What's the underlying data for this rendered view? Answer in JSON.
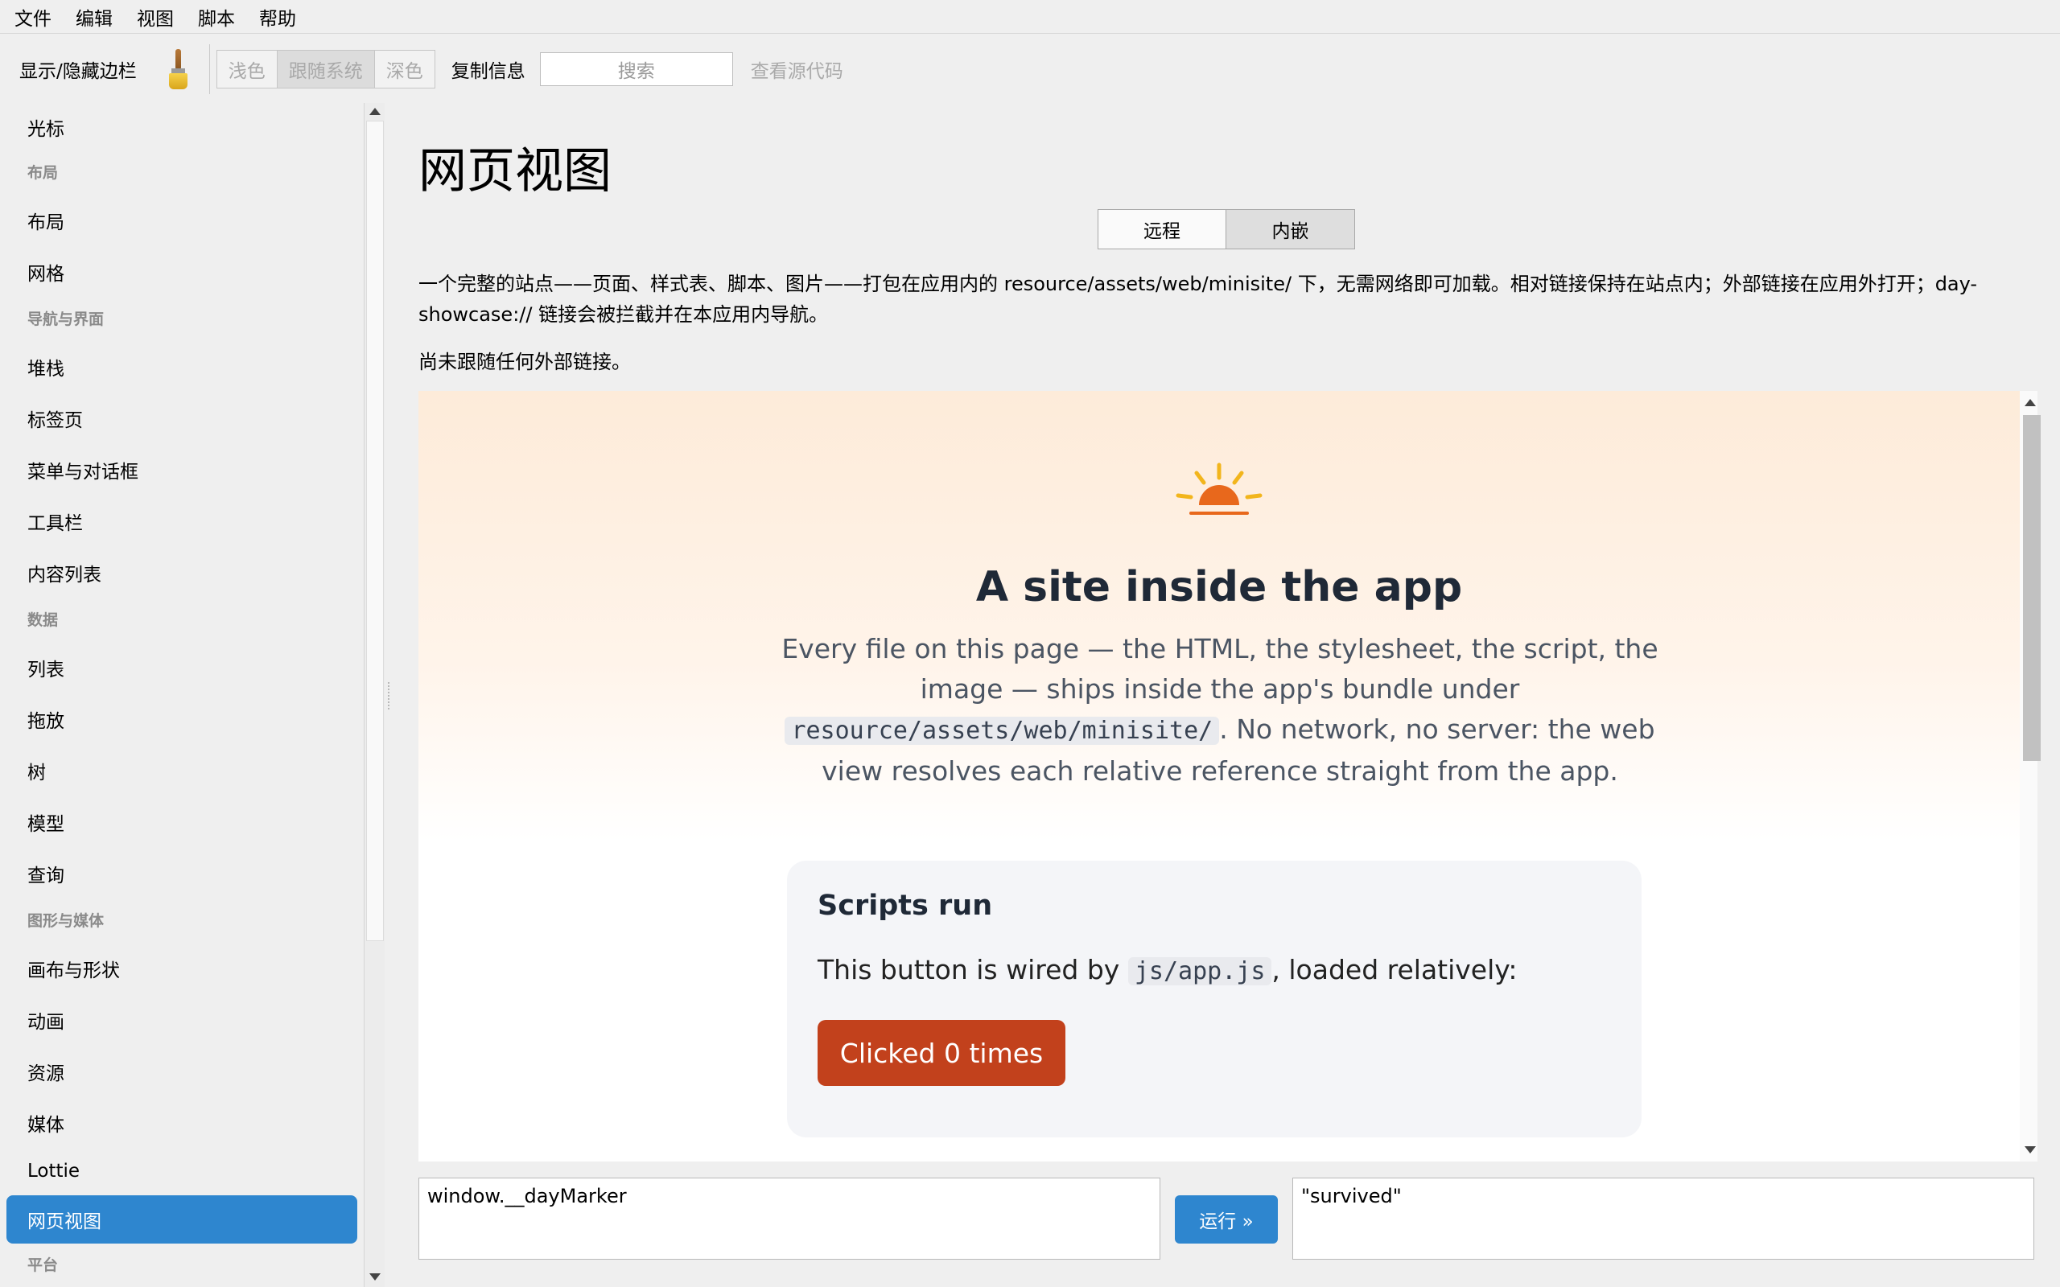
{
  "menubar": {
    "items": [
      {
        "label": "文件"
      },
      {
        "label": "编辑"
      },
      {
        "label": "视图"
      },
      {
        "label": "脚本"
      },
      {
        "label": "帮助"
      }
    ]
  },
  "toolbar": {
    "toggle_sidebar": "显示/隐藏边栏",
    "brush_icon": "paintbrush-icon",
    "theme_light": "浅色",
    "theme_system": "跟随系统",
    "theme_dark": "深色",
    "copy_info": "复制信息",
    "search_placeholder": "搜索",
    "view_source": "查看源代码"
  },
  "sidebar": {
    "items": [
      {
        "type": "item",
        "label": "光标"
      },
      {
        "type": "header",
        "label": "布局"
      },
      {
        "type": "item",
        "label": "布局"
      },
      {
        "type": "item",
        "label": "网格"
      },
      {
        "type": "header",
        "label": "导航与界面"
      },
      {
        "type": "item",
        "label": "堆栈"
      },
      {
        "type": "item",
        "label": "标签页"
      },
      {
        "type": "item",
        "label": "菜单与对话框"
      },
      {
        "type": "item",
        "label": "工具栏"
      },
      {
        "type": "item",
        "label": "内容列表"
      },
      {
        "type": "header",
        "label": "数据"
      },
      {
        "type": "item",
        "label": "列表"
      },
      {
        "type": "item",
        "label": "拖放"
      },
      {
        "type": "item",
        "label": "树"
      },
      {
        "type": "item",
        "label": "模型"
      },
      {
        "type": "item",
        "label": "查询"
      },
      {
        "type": "header",
        "label": "图形与媒体"
      },
      {
        "type": "item",
        "label": "画布与形状"
      },
      {
        "type": "item",
        "label": "动画"
      },
      {
        "type": "item",
        "label": "资源"
      },
      {
        "type": "item",
        "label": "媒体"
      },
      {
        "type": "item",
        "label": "Lottie"
      },
      {
        "type": "item",
        "label": "网页视图",
        "selected": true
      },
      {
        "type": "header",
        "label": "平台"
      }
    ],
    "selected_color": "#2e86cf"
  },
  "main": {
    "title": "网页视图",
    "modes": {
      "remote": "远程",
      "embedded": "内嵌",
      "active": "embedded"
    },
    "description": "一个完整的站点——页面、样式表、脚本、图片——打包在应用内的 resource/assets/web/minisite/ 下，无需网络即可加载。相对链接保持在站点内；外部链接在应用外打开；day-showcase:// 链接会被拦截并在本应用内导航。",
    "status": "尚未跟随任何外部链接。"
  },
  "webview": {
    "logo_icon": "sunrise-icon",
    "hero_title": "A site inside the app",
    "hero_text_1": "Every file on this page — the HTML, the stylesheet, the script, the image — ships inside the app's bundle under ",
    "hero_code": "resource/assets/web/minisite/",
    "hero_text_2": ". No network, no server: the web view resolves each relative reference straight from the app.",
    "card_title": "Scripts run",
    "card_text_1": "This button is wired by ",
    "card_code": "js/app.js",
    "card_text_2": ", loaded relatively:",
    "card_button": "Clicked 0 times",
    "accent_color": "#c2411c"
  },
  "console": {
    "input": "window.__dayMarker",
    "run_label": "运行 »",
    "output": "\"survived\""
  }
}
